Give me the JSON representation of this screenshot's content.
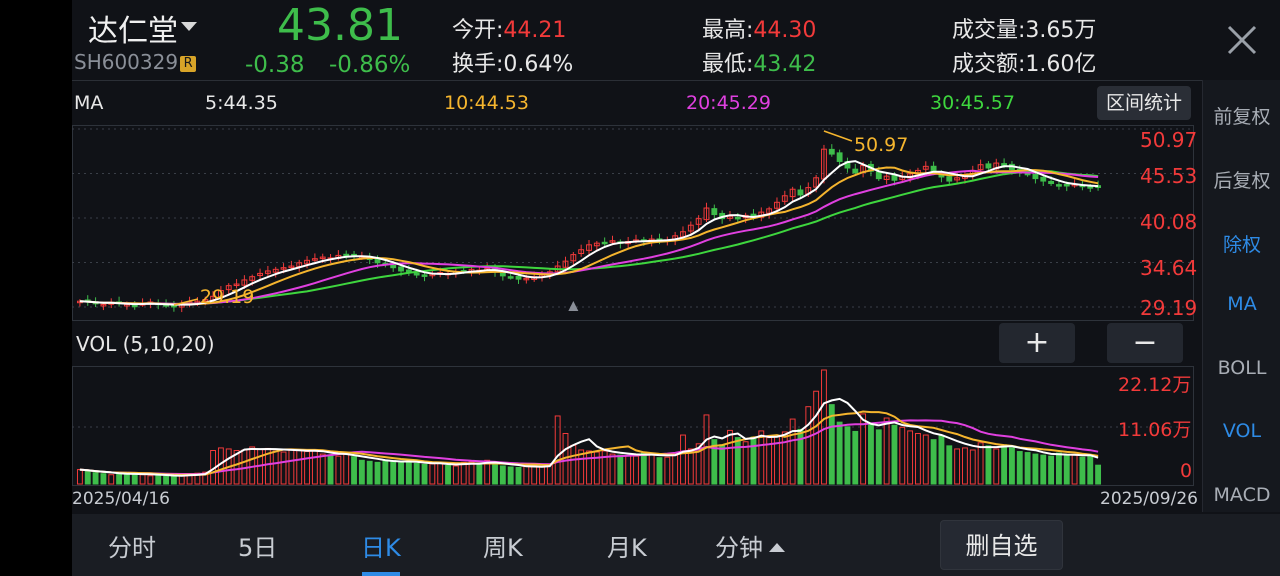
{
  "stock": {
    "name": "达仁堂",
    "code": "SH600329",
    "badge": "R",
    "price": "43.81",
    "change": "-0.38",
    "change_pct": "-0.86%"
  },
  "quote": {
    "open_label": "今开:",
    "open_value": "44.21",
    "turnover_label": "换手:",
    "turnover_value": "0.64%",
    "high_label": "最高:",
    "high_value": "44.30",
    "low_label": "最低:",
    "low_value": "43.42",
    "volume_label": "成交量:",
    "volume_value": "3.65万",
    "amount_label": "成交额:",
    "amount_value": "1.60亿"
  },
  "ma_bar": {
    "label": "MA",
    "ma5": "5:44.35",
    "ma10": "10:44.53",
    "ma20": "20:45.29",
    "ma30": "30:45.57",
    "range_stats_button": "区间统计"
  },
  "kline": {
    "price_labels": [
      "50.97",
      "45.53",
      "40.08",
      "34.64",
      "29.19"
    ],
    "high_marker": "50.97",
    "low_marker": "29.19"
  },
  "volume": {
    "title": "VOL (5,10,20)",
    "zoom_in_label": "+",
    "zoom_out_label": "−",
    "axis_labels": [
      "22.12万",
      "11.06万",
      "0"
    ],
    "start_date": "2025/04/16",
    "end_date": "2025/09/26"
  },
  "side_menu": [
    {
      "label": "前复权",
      "active": false
    },
    {
      "label": "后复权",
      "active": false
    },
    {
      "label": "除权",
      "active": true
    },
    {
      "label": "MA",
      "active": true
    },
    {
      "label": "BOLL",
      "active": false
    },
    {
      "label": "VOL",
      "active": true
    },
    {
      "label": "MACD",
      "active": false
    }
  ],
  "tabs": [
    {
      "label": "分时",
      "active": false
    },
    {
      "label": "5日",
      "active": false
    },
    {
      "label": "日K",
      "active": true
    },
    {
      "label": "周K",
      "active": false
    },
    {
      "label": "月K",
      "active": false
    },
    {
      "label": "分钟",
      "active": false
    }
  ],
  "remove_watchlist_button": "删自选",
  "colors": {
    "up": "#f23a3a",
    "down": "#3ebd4b",
    "ma5": "#ffffff",
    "ma10": "#f5b52e",
    "ma20": "#e040e0",
    "ma30": "#3ed63e",
    "accent": "#2e8be6"
  },
  "chart_data": [
    {
      "type": "candlestick",
      "ylim": [
        29.19,
        50.97
      ],
      "x_range": [
        "2025/04/16",
        "2025/09/26"
      ],
      "series": [
        {
          "name": "MA5",
          "last": 44.35
        },
        {
          "name": "MA10",
          "last": 44.53
        },
        {
          "name": "MA20",
          "last": 45.29
        },
        {
          "name": "MA30",
          "last": 45.57
        }
      ],
      "close": [
        29.9,
        29.8,
        29.6,
        29.5,
        29.7,
        29.6,
        29.5,
        29.4,
        29.6,
        29.8,
        29.5,
        29.3,
        29.2,
        29.6,
        29.8,
        29.9,
        30.1,
        30.5,
        31.2,
        31.8,
        32.0,
        32.5,
        32.9,
        33.3,
        33.6,
        33.8,
        34.0,
        34.2,
        34.6,
        34.9,
        35.1,
        35.3,
        35.2,
        35.5,
        35.6,
        35.4,
        35.3,
        35.0,
        34.6,
        34.4,
        34.0,
        33.6,
        33.4,
        33.2,
        33.0,
        33.2,
        33.4,
        33.3,
        33.5,
        33.6,
        33.8,
        33.7,
        33.9,
        33.5,
        33.0,
        32.8,
        32.6,
        32.7,
        32.9,
        33.1,
        33.5,
        34.2,
        34.8,
        35.6,
        36.2,
        36.8,
        37.0,
        37.1,
        37.3,
        37.0,
        37.2,
        37.4,
        37.3,
        37.5,
        37.2,
        37.4,
        37.9,
        38.4,
        39.2,
        40.0,
        41.3,
        40.5,
        40.0,
        40.3,
        40.1,
        40.4,
        40.2,
        40.8,
        41.2,
        42.0,
        42.8,
        43.6,
        42.9,
        43.8,
        45.0,
        48.5,
        47.9,
        47.0,
        46.2,
        45.6,
        46.5,
        45.8,
        44.9,
        45.2,
        44.7,
        45.1,
        45.5,
        45.9,
        46.4,
        45.8,
        45.1,
        44.6,
        45.0,
        45.4,
        45.9,
        46.6,
        46.2,
        46.8,
        46.5,
        46.0,
        45.7,
        45.4,
        44.9,
        44.6,
        44.3,
        44.1,
        44.0,
        44.2,
        44.0,
        43.9,
        43.81
      ],
      "volume_axis": {
        "max_label": "22.12万",
        "mid_label": "11.06万",
        "min_label": "0"
      },
      "volume": [
        2.8,
        2.5,
        2.2,
        2.0,
        1.8,
        2.0,
        1.9,
        2.1,
        1.8,
        1.6,
        1.7,
        1.5,
        1.6,
        1.7,
        1.9,
        2.1,
        2.3,
        6.5,
        7.0,
        6.8,
        6.5,
        6.6,
        7.2,
        6.8,
        6.9,
        6.4,
        6.2,
        6.8,
        6.5,
        6.3,
        6.4,
        5.8,
        5.6,
        5.4,
        5.9,
        5.3,
        4.6,
        4.4,
        4.2,
        4.6,
        4.5,
        4.1,
        4.4,
        4.0,
        3.8,
        3.9,
        4.1,
        3.6,
        3.5,
        4.2,
        4.3,
        4.0,
        4.6,
        3.8,
        3.5,
        3.3,
        3.2,
        3.4,
        3.6,
        3.3,
        3.9,
        13.2,
        9.8,
        7.5,
        6.6,
        6.4,
        6.2,
        6.4,
        5.8,
        5.6,
        5.5,
        5.4,
        6.2,
        5.8,
        5.1,
        5.2,
        5.6,
        9.5,
        6.8,
        7.8,
        13.4,
        8.6,
        7.6,
        10.4,
        9.0,
        8.2,
        9.1,
        10.3,
        9.0,
        9.3,
        10.1,
        12.6,
        10.6,
        15.0,
        18.0,
        22.12,
        15.4,
        12.0,
        11.1,
        10.2,
        13.6,
        11.5,
        10.5,
        12.8,
        11.4,
        11.0,
        10.3,
        9.8,
        9.5,
        8.6,
        9.3,
        7.4,
        6.8,
        7.0,
        6.6,
        8.0,
        7.4,
        6.8,
        7.6,
        7.0,
        6.3,
        6.1,
        5.8,
        5.6,
        5.4,
        6.0,
        5.7,
        5.6,
        5.2,
        5.4,
        3.65
      ]
    }
  ]
}
